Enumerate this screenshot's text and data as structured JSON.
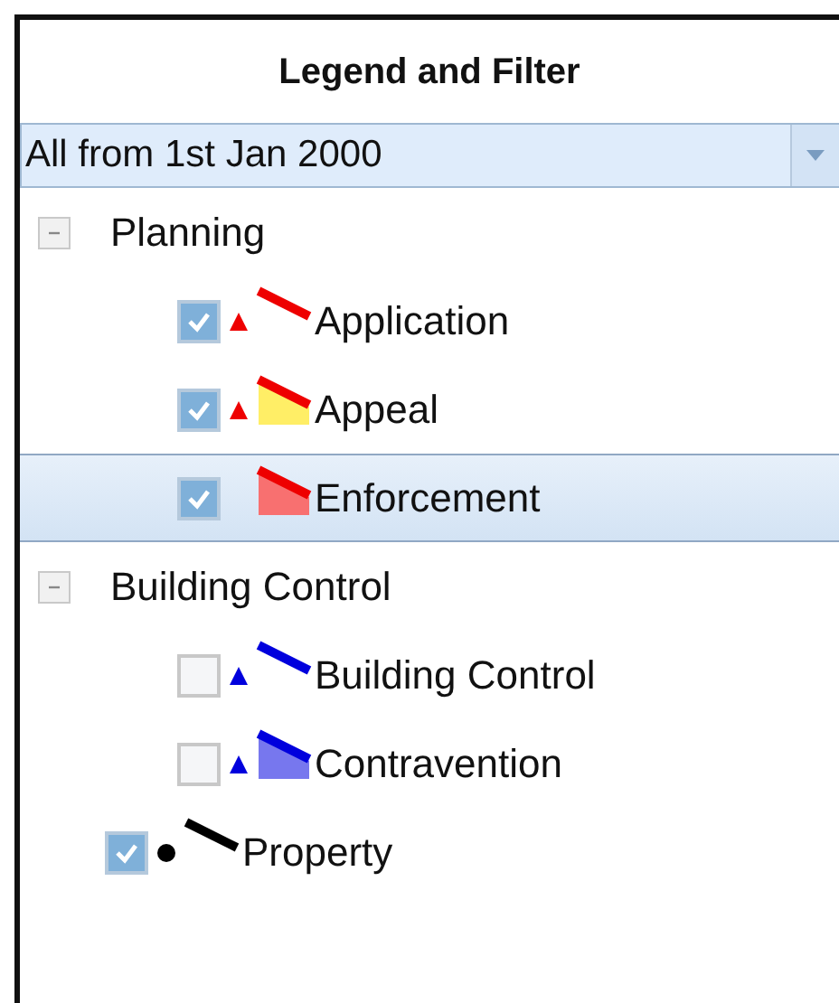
{
  "panel": {
    "title": "Legend and Filter"
  },
  "filter": {
    "value": "All from 1st Jan 2000"
  },
  "tree": [
    {
      "kind": "group",
      "label": "Planning",
      "expanded": true,
      "selected": false,
      "children": [
        {
          "kind": "layer",
          "label": "Application",
          "checked": true,
          "selected": false,
          "marker": {
            "kind": "triangle",
            "color": "#ee0000"
          },
          "line": {
            "color": "#ee0000"
          }
        },
        {
          "kind": "layer",
          "label": "Appeal",
          "checked": true,
          "selected": false,
          "marker": {
            "kind": "triangle",
            "color": "#ee0000"
          },
          "area": {
            "color": "#ffee66"
          },
          "line": {
            "color": "#ee0000"
          }
        },
        {
          "kind": "layer",
          "label": "Enforcement",
          "checked": true,
          "selected": true,
          "area": {
            "color": "#f87070"
          },
          "line": {
            "color": "#ee0000"
          }
        }
      ]
    },
    {
      "kind": "group",
      "label": "Building Control",
      "expanded": true,
      "selected": false,
      "children": [
        {
          "kind": "layer",
          "label": "Building Control",
          "checked": false,
          "selected": false,
          "marker": {
            "kind": "triangle",
            "color": "#0000dd"
          },
          "line": {
            "color": "#0000dd"
          }
        },
        {
          "kind": "layer",
          "label": "Contravention",
          "checked": false,
          "selected": false,
          "marker": {
            "kind": "triangle",
            "color": "#0000dd"
          },
          "area": {
            "color": "#7777ee"
          },
          "line": {
            "color": "#0000dd"
          }
        }
      ]
    },
    {
      "kind": "layer",
      "label": "Property",
      "checked": true,
      "selected": false,
      "marker": {
        "kind": "circle",
        "color": "#000000"
      },
      "line": {
        "color": "#000000"
      }
    }
  ]
}
